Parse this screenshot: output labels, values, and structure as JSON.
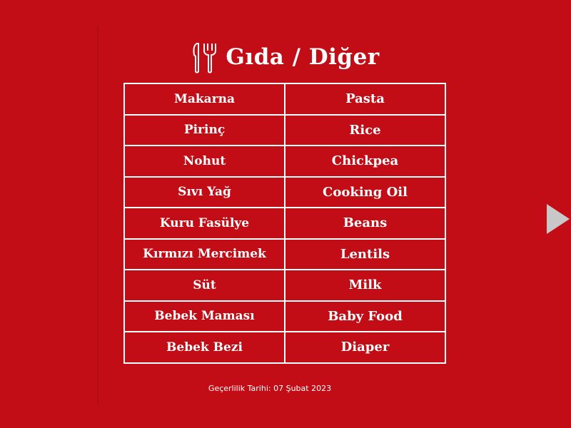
{
  "header": {
    "title": "Gıda / Diğer",
    "icon": "fork-knife-icon"
  },
  "table": {
    "rows": [
      {
        "tr": "Makarna",
        "en": "Pasta"
      },
      {
        "tr": "Pirinç",
        "en": "Rice"
      },
      {
        "tr": "Nohut",
        "en": "Chickpea"
      },
      {
        "tr": "Sıvı Yağ",
        "en": "Cooking Oil"
      },
      {
        "tr": "Kuru Fasülye",
        "en": "Beans"
      },
      {
        "tr": "Kırmızı Mercimek",
        "en": "Lentils"
      },
      {
        "tr": "Süt",
        "en": "Milk"
      },
      {
        "tr": "Bebek Maması",
        "en": "Baby Food"
      },
      {
        "tr": "Bebek Bezi",
        "en": "Diaper"
      }
    ]
  },
  "footer": {
    "validity": "Geçerlilik Tarihi: 07 Şubat 2023"
  },
  "navigation": {
    "next_icon": "triangle-right-icon"
  },
  "colors": {
    "background": "#c20d16",
    "text": "#ffffff",
    "arrow": "#c8c8c8"
  }
}
